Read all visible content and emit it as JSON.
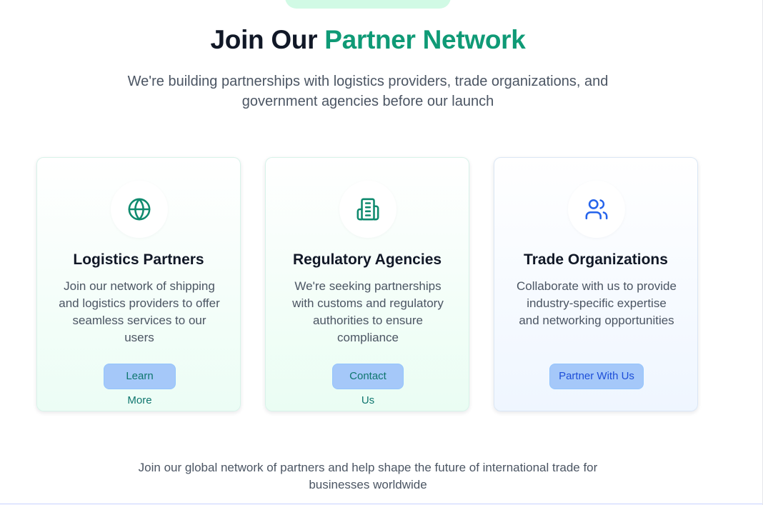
{
  "header": {
    "title_part1": "Join Our ",
    "title_part2": "Partner Network",
    "subtitle": "We're building partnerships with logistics providers, trade organizations, and government agencies before our launch"
  },
  "cards": [
    {
      "icon": "globe-icon",
      "title": "Logistics Partners",
      "description": "Join our network of shipping and logistics providers to offer seamless services to our users",
      "button_label": "Learn More"
    },
    {
      "icon": "building-icon",
      "title": "Regulatory Agencies",
      "description": "We're seeking partnerships with customs and regulatory authorities to ensure compliance",
      "button_label": "Contact Us"
    },
    {
      "icon": "users-icon",
      "title": "Trade Organizations",
      "description": "Collaborate with us to provide industry-specific expertise and networking opportunities",
      "button_label": "Partner With Us"
    }
  ],
  "footer": {
    "note": "Join our global network of partners and help shape the future of international trade for businesses worldwide"
  },
  "colors": {
    "accent": "#0f9a76",
    "heading": "#111827",
    "body_text": "#4b5563",
    "button_bg": "#a5c8f9",
    "icon_blue": "#2563eb"
  }
}
